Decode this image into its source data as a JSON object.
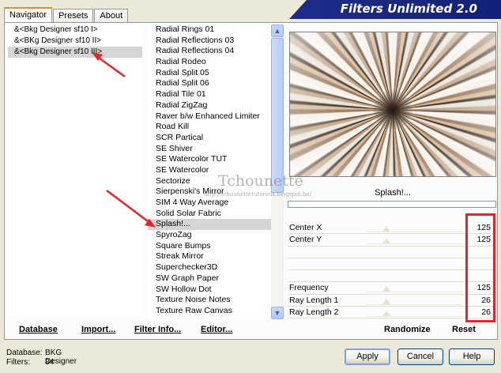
{
  "tabs": [
    {
      "label": "Navigator",
      "active": true
    },
    {
      "label": "Presets",
      "active": false
    },
    {
      "label": "About",
      "active": false
    }
  ],
  "app_title": "Filters Unlimited 2.0",
  "categories": [
    {
      "label": "&<Bkg Designer sf10 I>",
      "selected": false
    },
    {
      "label": "&<BKg Designer sf10 II>",
      "selected": false
    },
    {
      "label": "&<Bkg Designer sf10 III>",
      "selected": true
    }
  ],
  "filters": [
    {
      "label": "Radial  Rings 01",
      "selected": false
    },
    {
      "label": "Radial Reflections 03",
      "selected": false
    },
    {
      "label": "Radial Reflections 04",
      "selected": false
    },
    {
      "label": "Radial Rodeo",
      "selected": false
    },
    {
      "label": "Radial Split 05",
      "selected": false
    },
    {
      "label": "Radial Split 06",
      "selected": false
    },
    {
      "label": "Radial Tile 01",
      "selected": false
    },
    {
      "label": "Radial ZigZag",
      "selected": false
    },
    {
      "label": "Raver b/w Enhanced Limiter",
      "selected": false
    },
    {
      "label": "Road Kill",
      "selected": false
    },
    {
      "label": "SCR  Partical",
      "selected": false
    },
    {
      "label": "SE Shiver",
      "selected": false
    },
    {
      "label": "SE Watercolor TUT",
      "selected": false
    },
    {
      "label": "SE Watercolor",
      "selected": false
    },
    {
      "label": "Sectorize",
      "selected": false
    },
    {
      "label": "Sierpenski's Mirror",
      "selected": false
    },
    {
      "label": "SIM 4 Way Average",
      "selected": false
    },
    {
      "label": "Solid Solar Fabric",
      "selected": false
    },
    {
      "label": "Splash!...",
      "selected": true
    },
    {
      "label": "SpyroZag",
      "selected": false
    },
    {
      "label": "Square Bumps",
      "selected": false
    },
    {
      "label": "Streak Mirror",
      "selected": false
    },
    {
      "label": "Superchecker3D",
      "selected": false
    },
    {
      "label": "SW Graph Paper",
      "selected": false
    },
    {
      "label": "SW Hollow Dot",
      "selected": false
    },
    {
      "label": "Texture Noise Notes",
      "selected": false
    },
    {
      "label": "Texture Raw Canvas",
      "selected": false
    }
  ],
  "preview": {
    "filter_name": "Splash!...",
    "watermark": "Tchounette",
    "watermark_sub": "http://tchounettetutoriels.blogspot.be/"
  },
  "params": [
    {
      "label": "Center X",
      "value": "125"
    },
    {
      "label": "Center Y",
      "value": "125"
    },
    {
      "label": "",
      "value": ""
    },
    {
      "label": "",
      "value": ""
    },
    {
      "label": "",
      "value": ""
    },
    {
      "label": "Frequency",
      "value": "125"
    },
    {
      "label": "Ray Length 1",
      "value": "26"
    },
    {
      "label": "Ray Length 2",
      "value": "26"
    }
  ],
  "toolbar": {
    "database": "Database",
    "import": "Import...",
    "filter_info": "Filter Info...",
    "editor": "Editor...",
    "randomize": "Randomize",
    "reset": "Reset"
  },
  "status": {
    "database_label": "Database:",
    "database_value": "BKG Designer",
    "filters_label": "Filters:",
    "filters_value": "84"
  },
  "buttons": {
    "apply": "Apply",
    "cancel": "Cancel",
    "help": "Help"
  },
  "colors": {
    "highlight_red": "#e3262a",
    "title_bar": "#1a2678"
  }
}
